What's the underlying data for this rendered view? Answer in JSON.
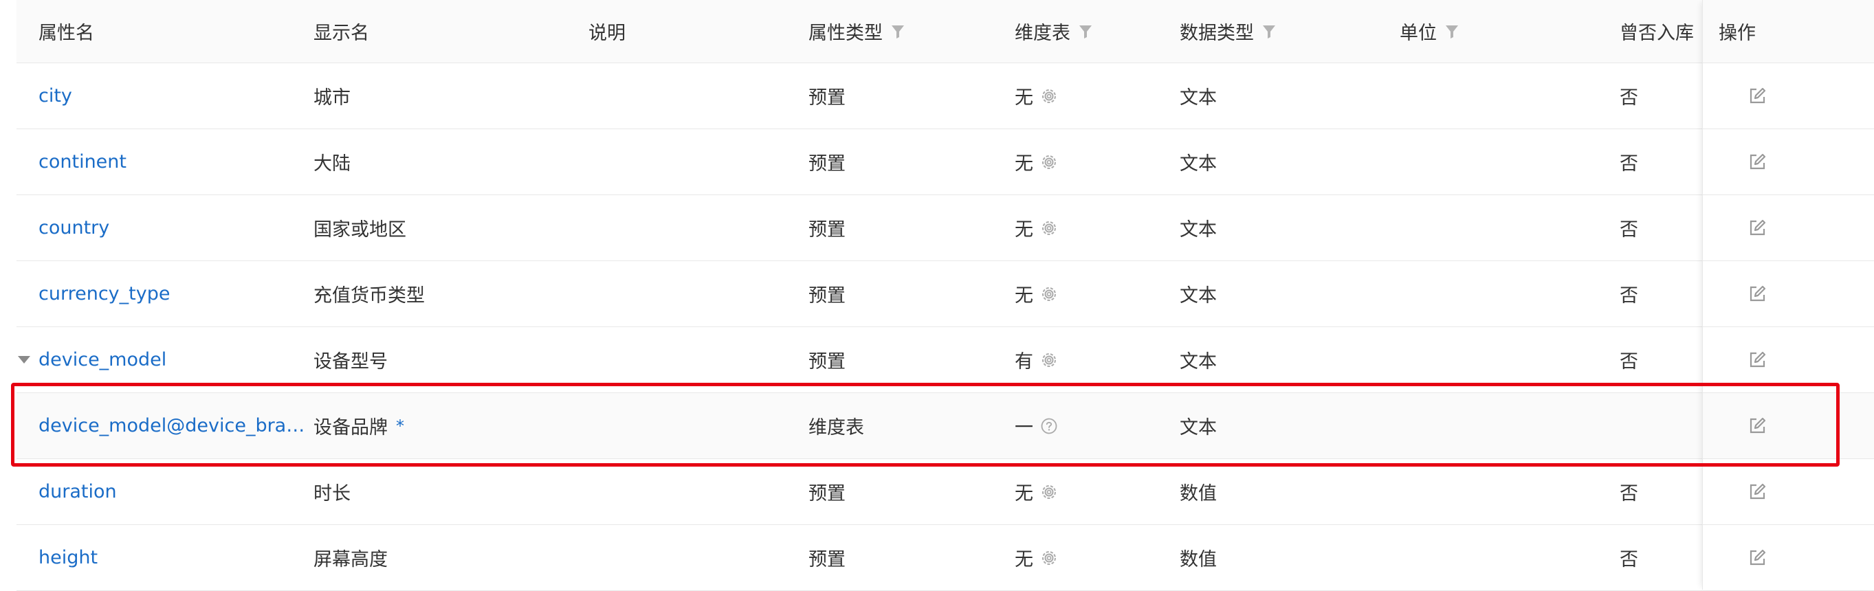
{
  "header": {
    "name": "属性名",
    "display": "显示名",
    "desc": "说明",
    "ptype": "属性类型",
    "dim": "维度表",
    "dtype": "数据类型",
    "unit": "单位",
    "stored": "曾否入库",
    "ops": "操作"
  },
  "rows": [
    {
      "name": "city",
      "display": "城市",
      "ptype": "预置",
      "dim": "无",
      "dtype": "文本",
      "stored": "否"
    },
    {
      "name": "continent",
      "display": "大陆",
      "ptype": "预置",
      "dim": "无",
      "dtype": "文本",
      "stored": "否"
    },
    {
      "name": "country",
      "display": "国家或地区",
      "ptype": "预置",
      "dim": "无",
      "dtype": "文本",
      "stored": "否"
    },
    {
      "name": "currency_type",
      "display": "充值货币类型",
      "ptype": "预置",
      "dim": "无",
      "dtype": "文本",
      "stored": "否"
    },
    {
      "name": "device_model",
      "display": "设备型号",
      "ptype": "预置",
      "dim": "有",
      "dtype": "文本",
      "stored": "否"
    },
    {
      "name": "device_model@device_bra…",
      "display": "设备品牌",
      "star": "*",
      "ptype": "维度表",
      "dim": "一",
      "dtype": "文本",
      "stored": ""
    },
    {
      "name": "duration",
      "display": "时长",
      "ptype": "预置",
      "dim": "无",
      "dtype": "数值",
      "stored": "否"
    },
    {
      "name": "height",
      "display": "屏幕高度",
      "ptype": "预置",
      "dim": "无",
      "dtype": "数值",
      "stored": "否"
    }
  ],
  "icons": {
    "filter": "filter-icon",
    "gear": "gear-icon",
    "help": "help-icon",
    "edit": "edit-icon",
    "expand": "caret-down-icon"
  },
  "colors": {
    "link": "#1a6cc7",
    "highlight_border": "#e60012",
    "icon_gray": "#aaaaaa"
  }
}
